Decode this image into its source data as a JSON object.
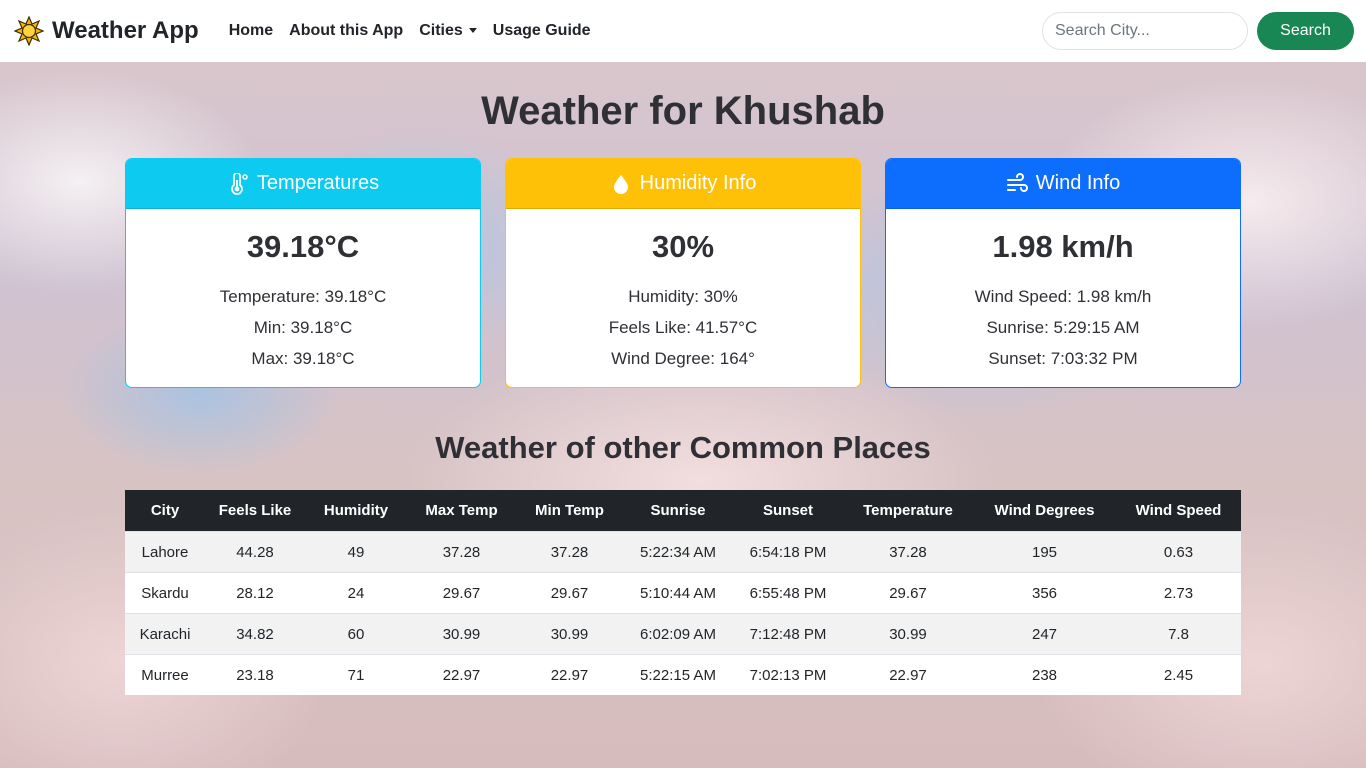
{
  "navbar": {
    "brand": "Weather App",
    "brand_icon": "sun-icon",
    "links": [
      "Home",
      "About this App",
      "Cities",
      "Usage Guide"
    ],
    "search_placeholder": "Search City...",
    "search_button": "Search"
  },
  "title": "Weather for Khushab",
  "cards": {
    "temperature": {
      "icon": "thermometer-icon",
      "header": "Temperatures",
      "main": "39.18°C",
      "lines": [
        "Temperature: 39.18°C",
        "Min: 39.18°C",
        "Max: 39.18°C"
      ]
    },
    "humidity": {
      "icon": "droplet-icon",
      "header": "Humidity Info",
      "main": "30%",
      "lines": [
        "Humidity: 30%",
        "Feels Like: 41.57°C",
        "Wind Degree: 164°"
      ]
    },
    "wind": {
      "icon": "wind-icon",
      "header": "Wind Info",
      "main": "1.98 km/h",
      "lines": [
        "Wind Speed: 1.98 km/h",
        "Sunrise: 5:29:15 AM",
        "Sunset: 7:03:32 PM"
      ]
    }
  },
  "places": {
    "title": "Weather of other Common Places",
    "columns": [
      "City",
      "Feels Like",
      "Humidity",
      "Max Temp",
      "Min Temp",
      "Sunrise",
      "Sunset",
      "Temperature",
      "Wind Degrees",
      "Wind Speed"
    ],
    "rows": [
      [
        "Lahore",
        "44.28",
        "49",
        "37.28",
        "37.28",
        "5:22:34 AM",
        "6:54:18 PM",
        "37.28",
        "195",
        "0.63"
      ],
      [
        "Skardu",
        "28.12",
        "24",
        "29.67",
        "29.67",
        "5:10:44 AM",
        "6:55:48 PM",
        "29.67",
        "356",
        "2.73"
      ],
      [
        "Karachi",
        "34.82",
        "60",
        "30.99",
        "30.99",
        "6:02:09 AM",
        "7:12:48 PM",
        "30.99",
        "247",
        "7.8"
      ],
      [
        "Murree",
        "23.18",
        "71",
        "22.97",
        "22.97",
        "5:22:15 AM",
        "7:02:13 PM",
        "22.97",
        "238",
        "2.45"
      ]
    ]
  },
  "colors": {
    "temperature": "#0dcaf0",
    "humidity": "#ffc107",
    "wind": "#0d6efd",
    "search_button": "#198754",
    "table_header": "#212529"
  }
}
